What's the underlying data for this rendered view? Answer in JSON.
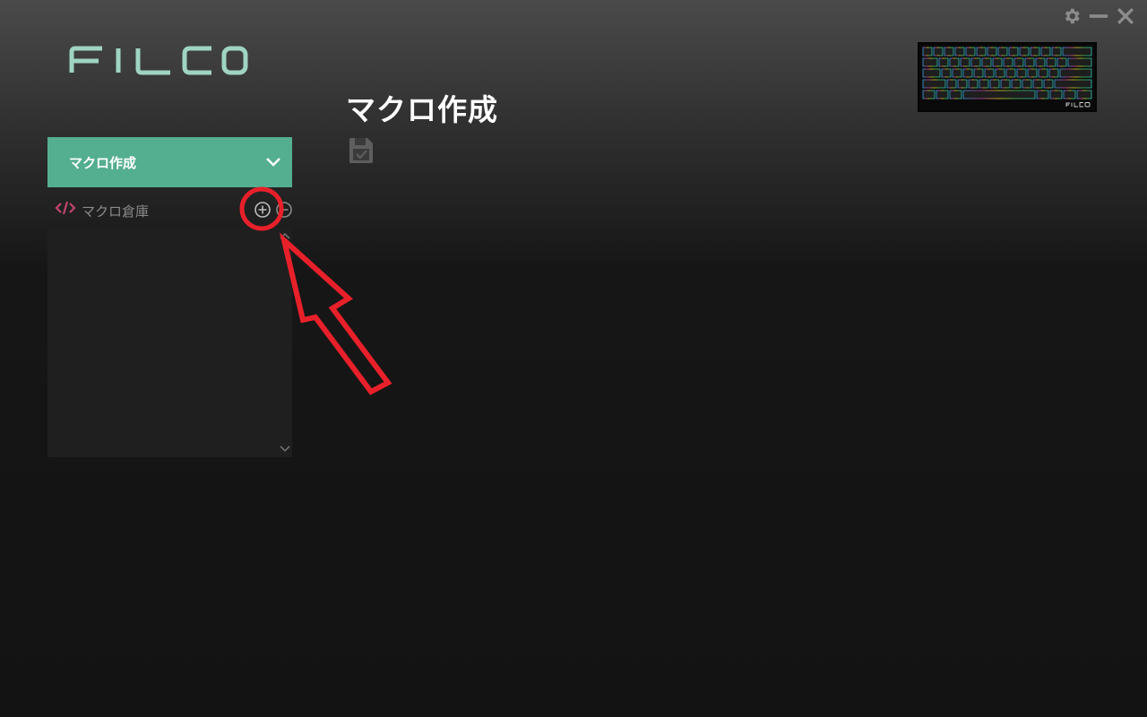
{
  "app": {
    "logo_text": "FILCO",
    "page_title": "マクロ作成"
  },
  "window_controls": {
    "settings_icon": "gear-icon",
    "minimize_icon": "minimize-icon",
    "close_icon": "close-icon"
  },
  "sidebar": {
    "header_label": "マクロ作成",
    "section_label": "マクロ倉庫",
    "macros": []
  },
  "colors": {
    "accent": "#54ae90",
    "logo": "#9fd4c2",
    "code_icon": "#c0456b",
    "annotation": "#e8202a"
  }
}
